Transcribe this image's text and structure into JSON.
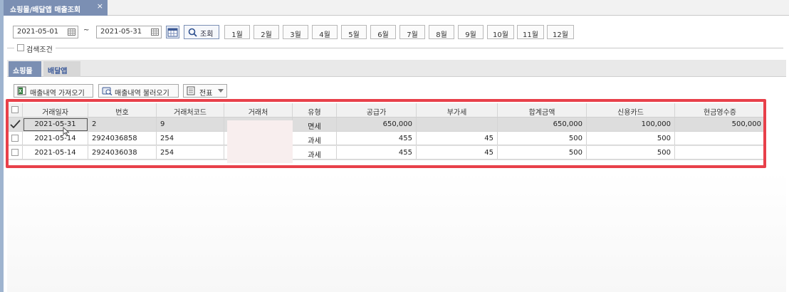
{
  "window": {
    "tab_title": "쇼핑몰/배달앱 매출조회",
    "close_glyph": "×"
  },
  "filter": {
    "date_from": "2021-05-01",
    "date_to": "2021-05-31",
    "separator": "~",
    "search_label": "조회",
    "months": [
      "1월",
      "2월",
      "3월",
      "4월",
      "5월",
      "6월",
      "7월",
      "8월",
      "9월",
      "10월",
      "11월",
      "12월"
    ],
    "condition_label": "검색조건"
  },
  "section_tabs": [
    {
      "label": "쇼핑몰",
      "active": true
    },
    {
      "label": "배달앱",
      "active": false
    }
  ],
  "toolbar": {
    "fetch_label": "매출내역 가져오기",
    "load_label": "매출내역 불러오기",
    "voucher_label": "전표"
  },
  "grid": {
    "headers": [
      "거래일자",
      "번호",
      "거래처코드",
      "거래처",
      "유형",
      "공급가",
      "부가세",
      "합계금액",
      "신용카드",
      "현금영수증"
    ],
    "rows": [
      {
        "checked": true,
        "date": "2021-05-31",
        "number": "2",
        "vendor_code": "9",
        "vendor": "",
        "type": "면세",
        "supply": "650,000",
        "vat": "",
        "total": "650,000",
        "card": "100,000",
        "cash_receipt": "500,000"
      },
      {
        "checked": false,
        "date": "2021-05-14",
        "number": "2924036858",
        "vendor_code": "254",
        "vendor": "",
        "type": "과세",
        "supply": "455",
        "vat": "45",
        "total": "500",
        "card": "500",
        "cash_receipt": ""
      },
      {
        "checked": false,
        "date": "2021-05-14",
        "number": "2924036038",
        "vendor_code": "254",
        "vendor": "",
        "type": "과세",
        "supply": "455",
        "vat": "45",
        "total": "500",
        "card": "500",
        "cash_receipt": ""
      }
    ]
  },
  "colors": {
    "tab_accent": "#7b8fb3",
    "highlight": "#e8404a"
  }
}
